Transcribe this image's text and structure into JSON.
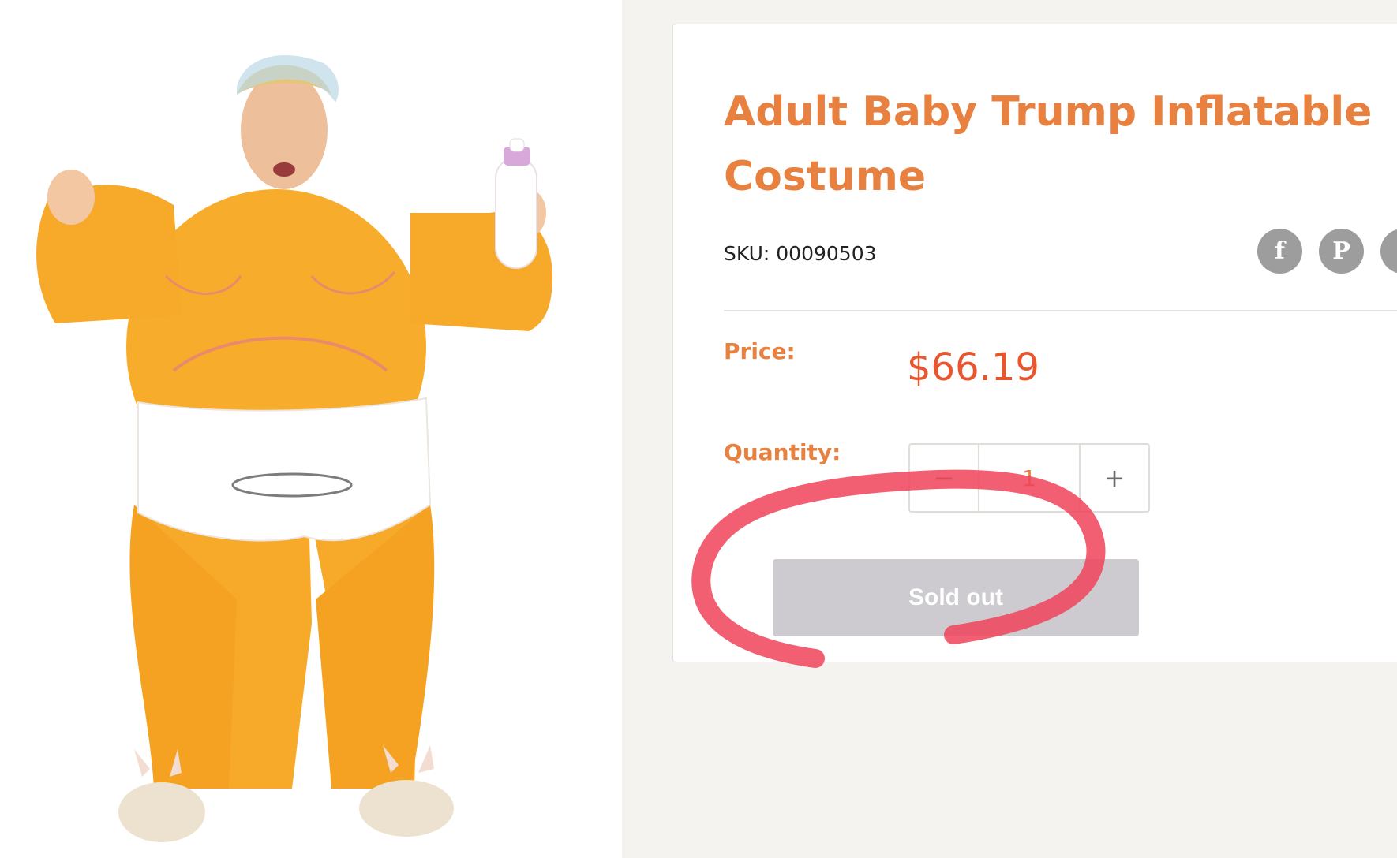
{
  "product": {
    "title": "Adult Baby Trump Inflatable Costume",
    "sku": "SKU: 00090503",
    "price_label": "Price:",
    "price": "$66.19",
    "quantity_label": "Quantity:",
    "quantity_value": "1",
    "minus_label": "−",
    "plus_label": "+",
    "sold_out_label": "Sold out"
  },
  "share": {
    "facebook": "f",
    "pinterest": "P"
  },
  "colors": {
    "accent": "#e8813f",
    "price": "#e8562f",
    "annotation": "#f0435a",
    "sold_out_bg": "#cdcbcf"
  },
  "icons": [
    "facebook-icon",
    "pinterest-icon",
    "twitter-icon"
  ]
}
